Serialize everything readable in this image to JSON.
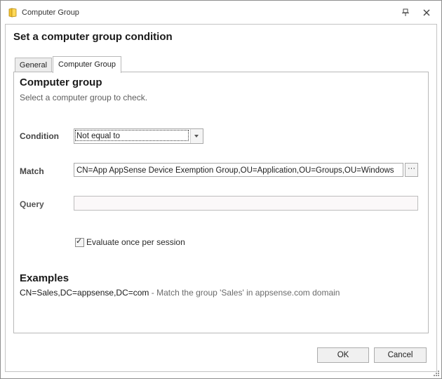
{
  "window": {
    "title": "Computer Group"
  },
  "dialog": {
    "heading": "Set a computer group condition"
  },
  "tabs": [
    {
      "label": "General",
      "selected": false
    },
    {
      "label": "Computer Group",
      "selected": true
    }
  ],
  "panel": {
    "title": "Computer group",
    "description": "Select a computer group to check.",
    "condition": {
      "label": "Condition",
      "selected_value": "Not equal to"
    },
    "match": {
      "label": "Match",
      "value": "CN=App AppSense Device Exemption Group,OU=Application,OU=Groups,OU=Windows",
      "browse_label": "···"
    },
    "query": {
      "label": "Query",
      "value": ""
    },
    "evaluate_once": {
      "label": "Evaluate once per session",
      "checked": true
    },
    "examples": {
      "title": "Examples",
      "code": "CN=Sales,DC=appsense,DC=com",
      "description": " - Match the group 'Sales' in appsense.com domain"
    }
  },
  "buttons": {
    "ok": "OK",
    "cancel": "Cancel"
  },
  "icons": {
    "app": "folder-icon",
    "pin": "pin-icon",
    "close": "close-icon",
    "resize": "resize-grip-icon"
  }
}
